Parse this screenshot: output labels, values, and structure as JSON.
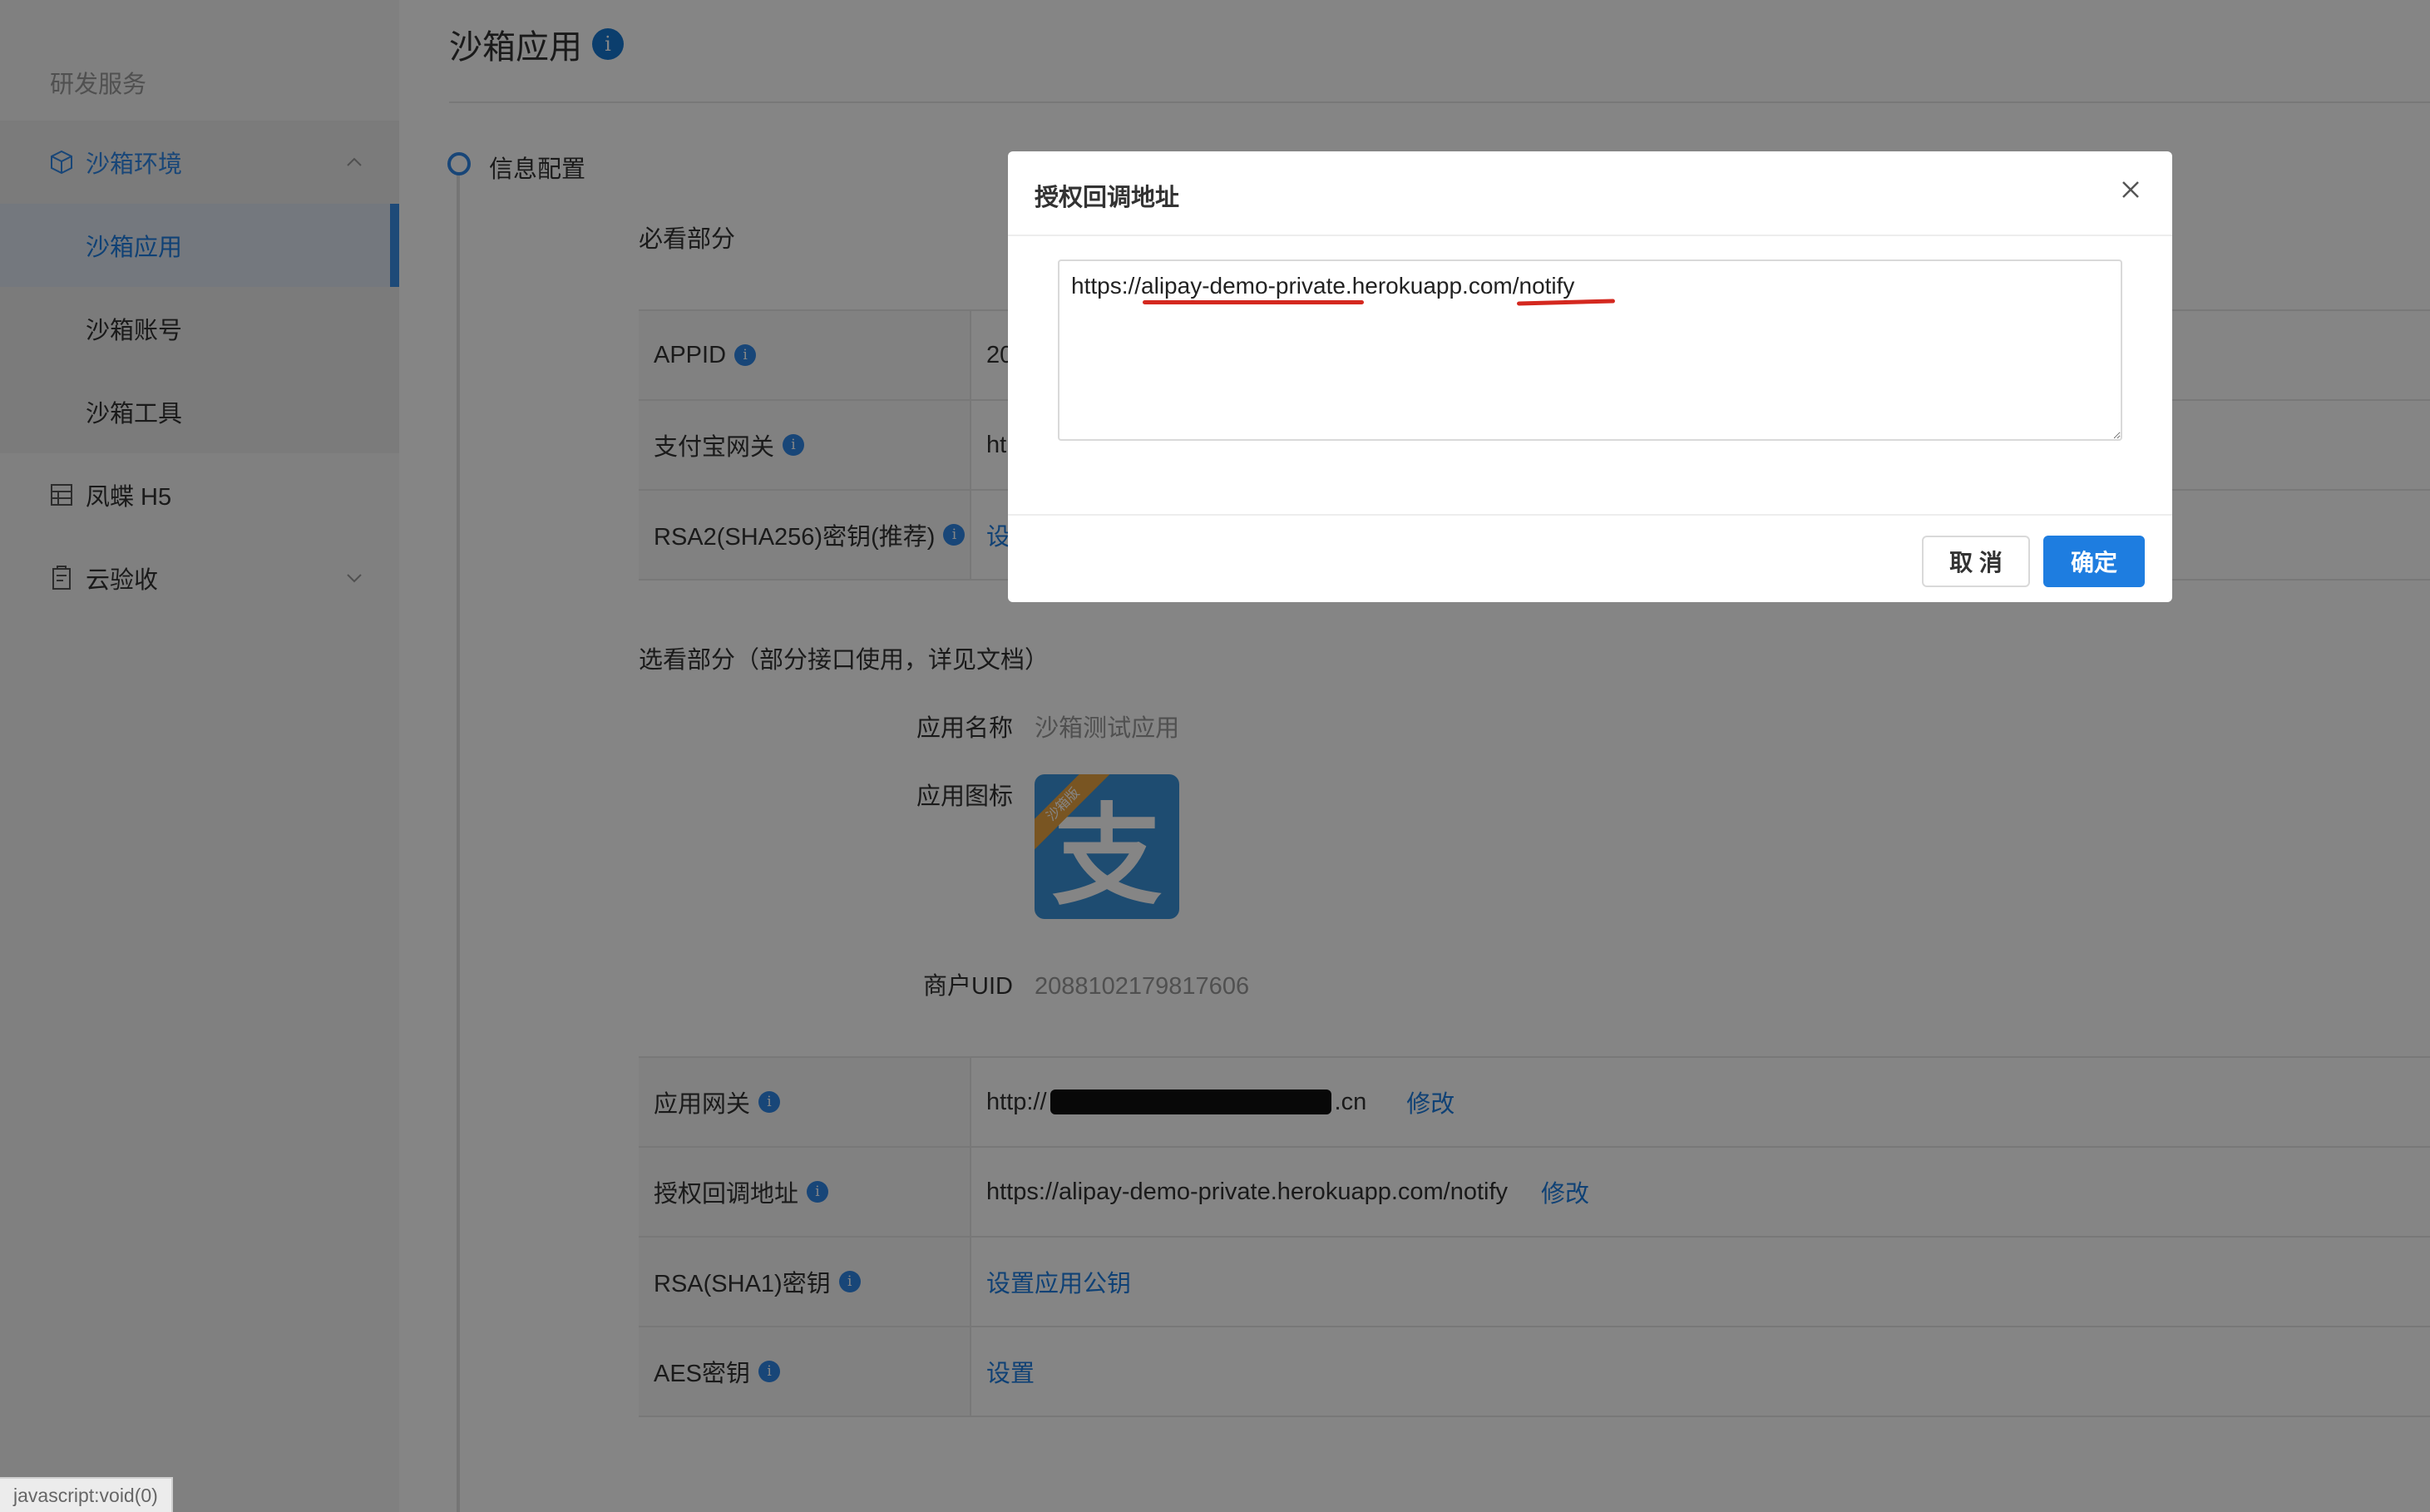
{
  "sidebar": {
    "section_title": "研发服务",
    "group": {
      "label": "沙箱环境"
    },
    "items": [
      {
        "label": "沙箱应用"
      },
      {
        "label": "沙箱账号"
      },
      {
        "label": "沙箱工具"
      }
    ],
    "menu2": {
      "label": "凤蝶 H5"
    },
    "menu3": {
      "label": "云验收"
    }
  },
  "page": {
    "title": "沙箱应用",
    "step_label": "信息配置",
    "required_label": "必看部分",
    "required_rows": [
      {
        "key": "APPID",
        "value": "20"
      },
      {
        "key": "支付宝网关",
        "value": "ht"
      },
      {
        "key": "RSA2(SHA256)密钥(推荐)",
        "value": "设"
      }
    ],
    "optional_label": "选看部分（部分接口使用，详见文档）",
    "app_name_key": "应用名称",
    "app_name_value": "沙箱测试应用",
    "app_icon_key": "应用图标",
    "app_icon_glyph": "支",
    "app_icon_ribbon": "沙箱版",
    "uid_key": "商户UID",
    "uid_value": "2088102179817606",
    "optional_rows": {
      "gateway": {
        "key": "应用网关",
        "prefix": "http://",
        "suffix": ".cn",
        "action": "修改"
      },
      "callback": {
        "key": "授权回调地址",
        "value": "https://alipay-demo-private.herokuapp.com/notify",
        "action": "修改"
      },
      "rsa1": {
        "key": "RSA(SHA1)密钥",
        "action": "设置应用公钥"
      },
      "aes": {
        "key": "AES密钥",
        "action": "设置"
      }
    }
  },
  "modal": {
    "title": "授权回调地址",
    "textarea_value": "https://alipay-demo-private.herokuapp.com/notify",
    "cancel_label": "取 消",
    "ok_label": "确定"
  },
  "status_bar": {
    "text": "javascript:void(0)"
  },
  "colors": {
    "accent": "#1e7de0",
    "annotation": "#d4281f",
    "overlay": "rgba(0,0,0,0.48)"
  }
}
